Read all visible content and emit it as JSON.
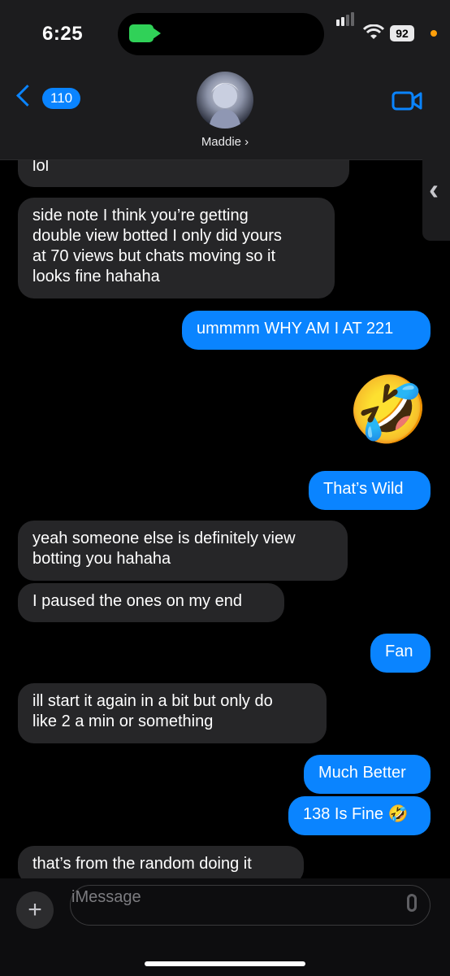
{
  "status_bar": {
    "time": "6:25",
    "battery": "92"
  },
  "header": {
    "back_count": "110",
    "contact_name": "Maddie ›"
  },
  "messages": [
    {
      "side": "in",
      "text": "lol"
    },
    {
      "side": "in",
      "text": "side note I think you’re getting\ndouble view botted I only did yours\nat 70 views but chats moving so it\nlooks fine hahaha"
    },
    {
      "side": "out",
      "text": "ummmm WHY AM I AT 221"
    },
    {
      "side": "out",
      "text": "🤣"
    },
    {
      "side": "out",
      "text": "That’s Wild"
    },
    {
      "side": "in",
      "text": "yeah someone else is definitely view\nbotting you hahaha"
    },
    {
      "side": "in",
      "text": "I paused the ones on my end"
    },
    {
      "side": "out",
      "text": "Fan"
    },
    {
      "side": "in",
      "text": "ill start it again in a bit but only do\nlike 2 a min or something"
    },
    {
      "side": "out",
      "text": "Much Better"
    },
    {
      "side": "out",
      "text": "138 Is Fine 🤣"
    },
    {
      "side": "in",
      "text": "that’s from the random doing it"
    }
  ],
  "composer": {
    "placeholder": "iMessage"
  },
  "icons": [
    "facetime-icon",
    "back-chevron-icon",
    "video-call-icon",
    "plus-icon",
    "microphone-icon",
    "signal-icon",
    "wifi-icon",
    "battery-icon"
  ],
  "colors": {
    "bubble_out": "#0a84ff",
    "bubble_in": "#262628",
    "header": "#1c1c1e"
  }
}
